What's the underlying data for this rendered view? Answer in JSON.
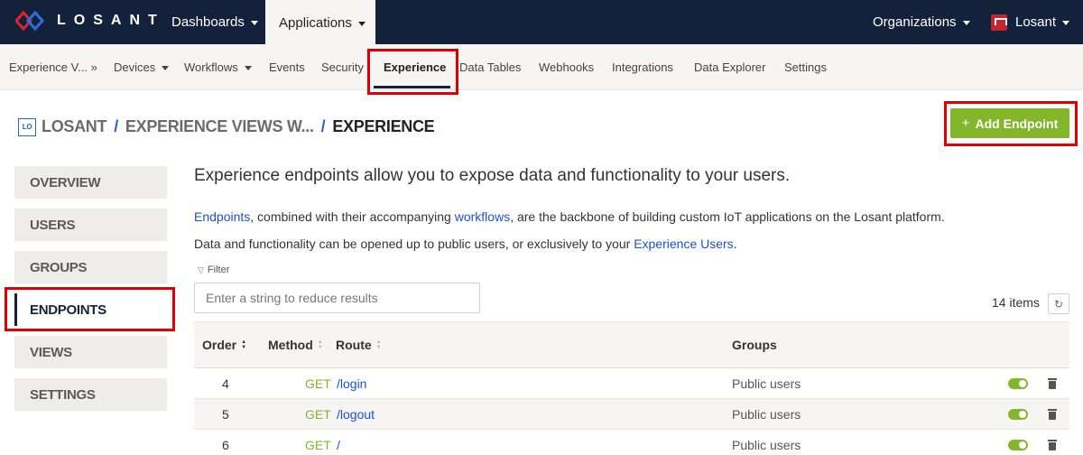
{
  "brand": {
    "name": "LOSANT"
  },
  "topnav": {
    "dashboards": "Dashboards",
    "applications": "Applications",
    "organizations": "Organizations",
    "user": "Losant"
  },
  "subnav": {
    "items": [
      "Experience V... »",
      "Devices",
      "Workflows",
      "Events",
      "Security",
      "Experience",
      "Data Tables",
      "Webhooks",
      "Integrations",
      "Data Explorer",
      "Settings"
    ],
    "active": "Experience"
  },
  "breadcrumb": {
    "app_icon": "LO",
    "parts": [
      "LOSANT",
      "EXPERIENCE VIEWS W...",
      "EXPERIENCE"
    ],
    "separator": "/"
  },
  "add_button": {
    "label": "Add Endpoint",
    "icon": "+"
  },
  "sidenav": {
    "items": [
      "OVERVIEW",
      "USERS",
      "GROUPS",
      "ENDPOINTS",
      "VIEWS",
      "SETTINGS"
    ],
    "active": "ENDPOINTS"
  },
  "main": {
    "intro": "Experience endpoints allow you to expose data and functionality to your users.",
    "para1": {
      "link1": "Endpoints",
      "text1": ", combined with their accompanying ",
      "link2": "workflows",
      "text2": ", are the backbone of building custom IoT applications on the Losant platform."
    },
    "para2": {
      "text1": "Data and functionality can be opened up to public users, or exclusively to your ",
      "link": "Experience Users",
      "text2": "."
    },
    "filter": {
      "label": "Filter",
      "placeholder": "Enter a string to reduce results",
      "value": ""
    },
    "items_count": "14 items"
  },
  "table": {
    "headers": {
      "order": "Order",
      "method": "Method",
      "route": "Route",
      "groups": "Groups"
    },
    "rows": [
      {
        "order": "4",
        "method": "GET",
        "route": "/login",
        "groups": "Public users",
        "enabled": true
      },
      {
        "order": "5",
        "method": "GET",
        "route": "/logout",
        "groups": "Public users",
        "enabled": true
      },
      {
        "order": "6",
        "method": "GET",
        "route": "/",
        "groups": "Public users",
        "enabled": true
      }
    ]
  },
  "colors": {
    "topbar": "#14213a",
    "accent_green": "#84b62b",
    "link_blue": "#1d4fd8",
    "highlight_red": "#e00000"
  },
  "icons": {
    "logo": "losant-logo-icon",
    "org": "organization-icon",
    "refresh": "refresh-icon",
    "trash": "trash-icon",
    "filter": "filter-icon"
  }
}
